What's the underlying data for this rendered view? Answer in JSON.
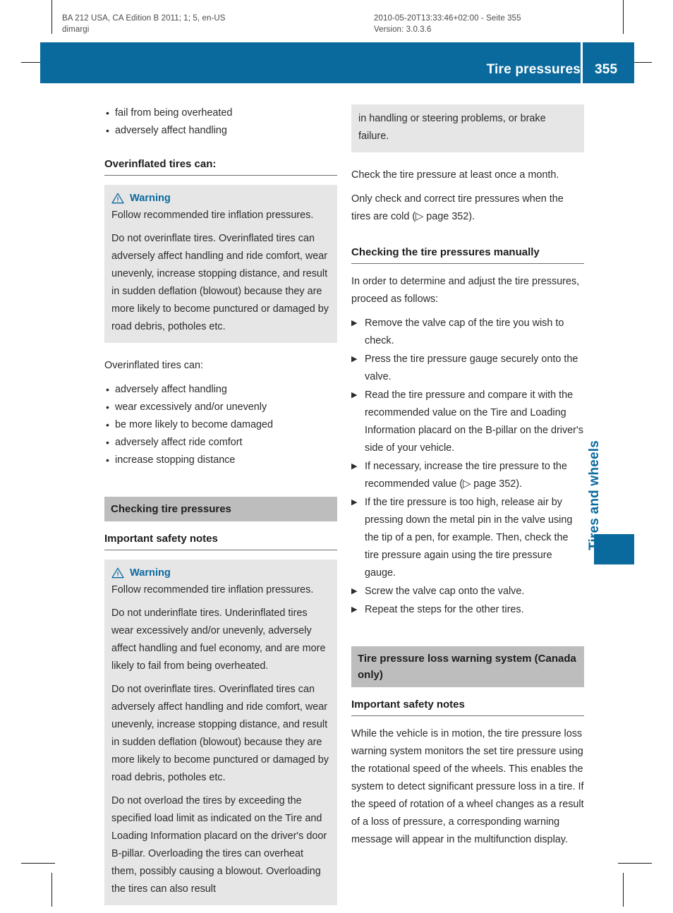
{
  "meta": {
    "left_line1": "BA 212 USA, CA Edition B 2011; 1; 5, en-US",
    "left_line2": "dimargi",
    "right_line1": "2010-05-20T13:33:46+02:00 - Seite 355",
    "right_line2": "Version: 3.0.3.6"
  },
  "header": {
    "title": "Tire pressures",
    "page_number": "355",
    "accent_color": "#0a6a9e"
  },
  "chapter_tab": {
    "label": "Tires and wheels",
    "color": "#0a6a9e"
  },
  "left_column": {
    "top_bullets": [
      "fail from being overheated",
      "adversely affect handling"
    ],
    "overinflated_heading": "Overinflated tires can:",
    "warning_1": {
      "icon": "warning-triangle-icon",
      "title": "Warning",
      "paragraphs": [
        "Follow recommended tire inflation pressures.",
        "Do not overinflate tires. Overinflated tires can adversely affect handling and ride comfort, wear unevenly, increase stopping distance, and result in sudden deflation (blowout) because they are more likely to become punctured or damaged by road debris, potholes etc."
      ]
    },
    "overinflated_intro": "Overinflated tires can:",
    "overinflated_bullets": [
      "adversely affect handling",
      "wear excessively and/or unevenly",
      "be more likely to become damaged",
      "adversely affect ride comfort",
      "increase stopping distance"
    ],
    "section_heading": "Checking tire pressures",
    "sub_heading": "Important safety notes",
    "warning_2": {
      "icon": "warning-triangle-icon",
      "title": "Warning",
      "paragraphs": [
        "Follow recommended tire inflation pressures.",
        "Do not underinflate tires. Underinflated tires wear excessively and/or unevenly, adversely affect handling and fuel economy, and are more likely to fail from being overheated.",
        "Do not overinflate tires. Overinflated tires can adversely affect handling and ride comfort, wear unevenly, increase stopping distance, and result in sudden deflation (blowout) because they are more likely to become punctured or damaged by road debris, potholes etc.",
        "Do not overload the tires by exceeding the specified load limit as indicated on the Tire and Loading Information placard on the driver's door B-pillar. Overloading the tires can overheat them, possibly causing a blowout. Overloading the tires can also result"
      ]
    }
  },
  "right_column": {
    "warning_continuation": "in handling or steering problems, or brake failure.",
    "intro_paragraphs": [
      "Check the tire pressure at least once a month.",
      "Only check and correct tire pressures when the tires are cold (▷ page 352)."
    ],
    "manual_heading": "Checking the tire pressures manually",
    "manual_intro": "In order to determine and adjust the tire pressures, proceed as follows:",
    "steps": [
      "Remove the valve cap of the tire you wish to check.",
      "Press the tire pressure gauge securely onto the valve.",
      "Read the tire pressure and compare it with the recommended value on the Tire and Loading Information placard on the B-pillar on the driver's side of your vehicle.",
      "If necessary, increase the tire pressure to the recommended value (▷ page 352).",
      "If the tire pressure is too high, release air by pressing down the metal pin in the valve using the tip of a pen, for example. Then, check the tire pressure again using the tire pressure gauge.",
      "Screw the valve cap onto the valve.",
      "Repeat the steps for the other tires."
    ],
    "section_heading": "Tire pressure loss warning system (Canada only)",
    "sub_heading": "Important safety notes",
    "body_paragraph": "While the vehicle is in motion, the tire pressure loss warning system monitors the set tire pressure using the rotational speed of the wheels. This enables the system to detect significant pressure loss in a tire. If the speed of rotation of a wheel changes as a result of a loss of pressure, a corresponding warning message will appear in the multifunction display."
  }
}
